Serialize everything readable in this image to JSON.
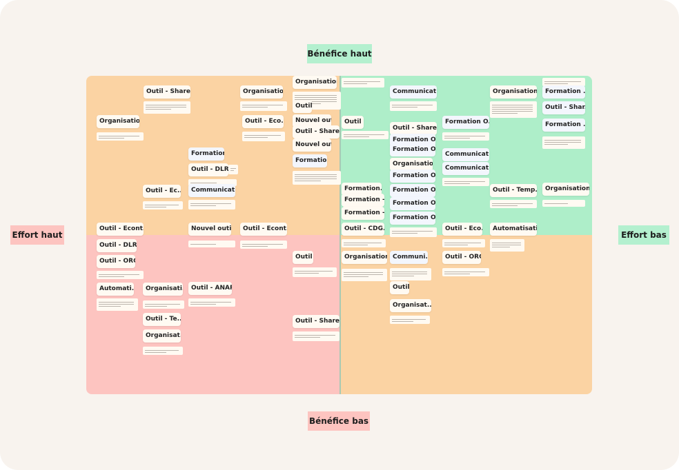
{
  "axes": {
    "top": "Bénéfice haut",
    "bottom": "Bénéfice bas",
    "left": "Effort haut",
    "right": "Effort bas"
  },
  "colors": {
    "background": "#f8f3ee",
    "quadrant_top_left": "#fbd3a3",
    "quadrant_top_right": "#aeeec9",
    "quadrant_bottom_left": "#fdc4c0",
    "quadrant_bottom_right": "#fbd3a3",
    "label_green": "#b4f0cf",
    "label_pink": "#fdc4c0"
  },
  "cards": [
    "Outil - Share...",
    "Organisation",
    "Organisation",
    "Outil - Eco...",
    "Formation",
    "Outil - DLRé",
    "Communicat...",
    "Outil - Ec...",
    "Organisation",
    "Outil",
    "Nouvel outil",
    "Outil - Share...",
    "Nouvel outil",
    "Formation",
    "Outil - Econt...",
    "Nouvel outil",
    "Outil - Econt...",
    "Outil",
    "Communicat...",
    "Outil - Share...",
    "Formation O...",
    "Formation O...",
    "Organisation",
    "Formation O...",
    "Formation O...",
    "Formation O...",
    "Formation O...",
    "Formation...",
    "Formation - ...",
    "Formation - ...",
    "Outil - CDG...",
    "Formation O...",
    "Communicat...",
    "Communicat...",
    "Outil - Eco...",
    "Organisation...",
    "Outil - Temp...",
    "Automatisati...",
    "Formation ...",
    "Outil - Shar...",
    "Formation ...",
    "Organisation...",
    "Outil - DLRé",
    "Outil - ORC",
    "Automati...",
    "Organisati...",
    "Outil - Te...",
    "Organisat...",
    "Outil - ANAFI",
    "Outil",
    "Outil - Share...",
    "Organisation...",
    "Communi...",
    "Outil",
    "Organisat...",
    "Outil - ORC"
  ]
}
